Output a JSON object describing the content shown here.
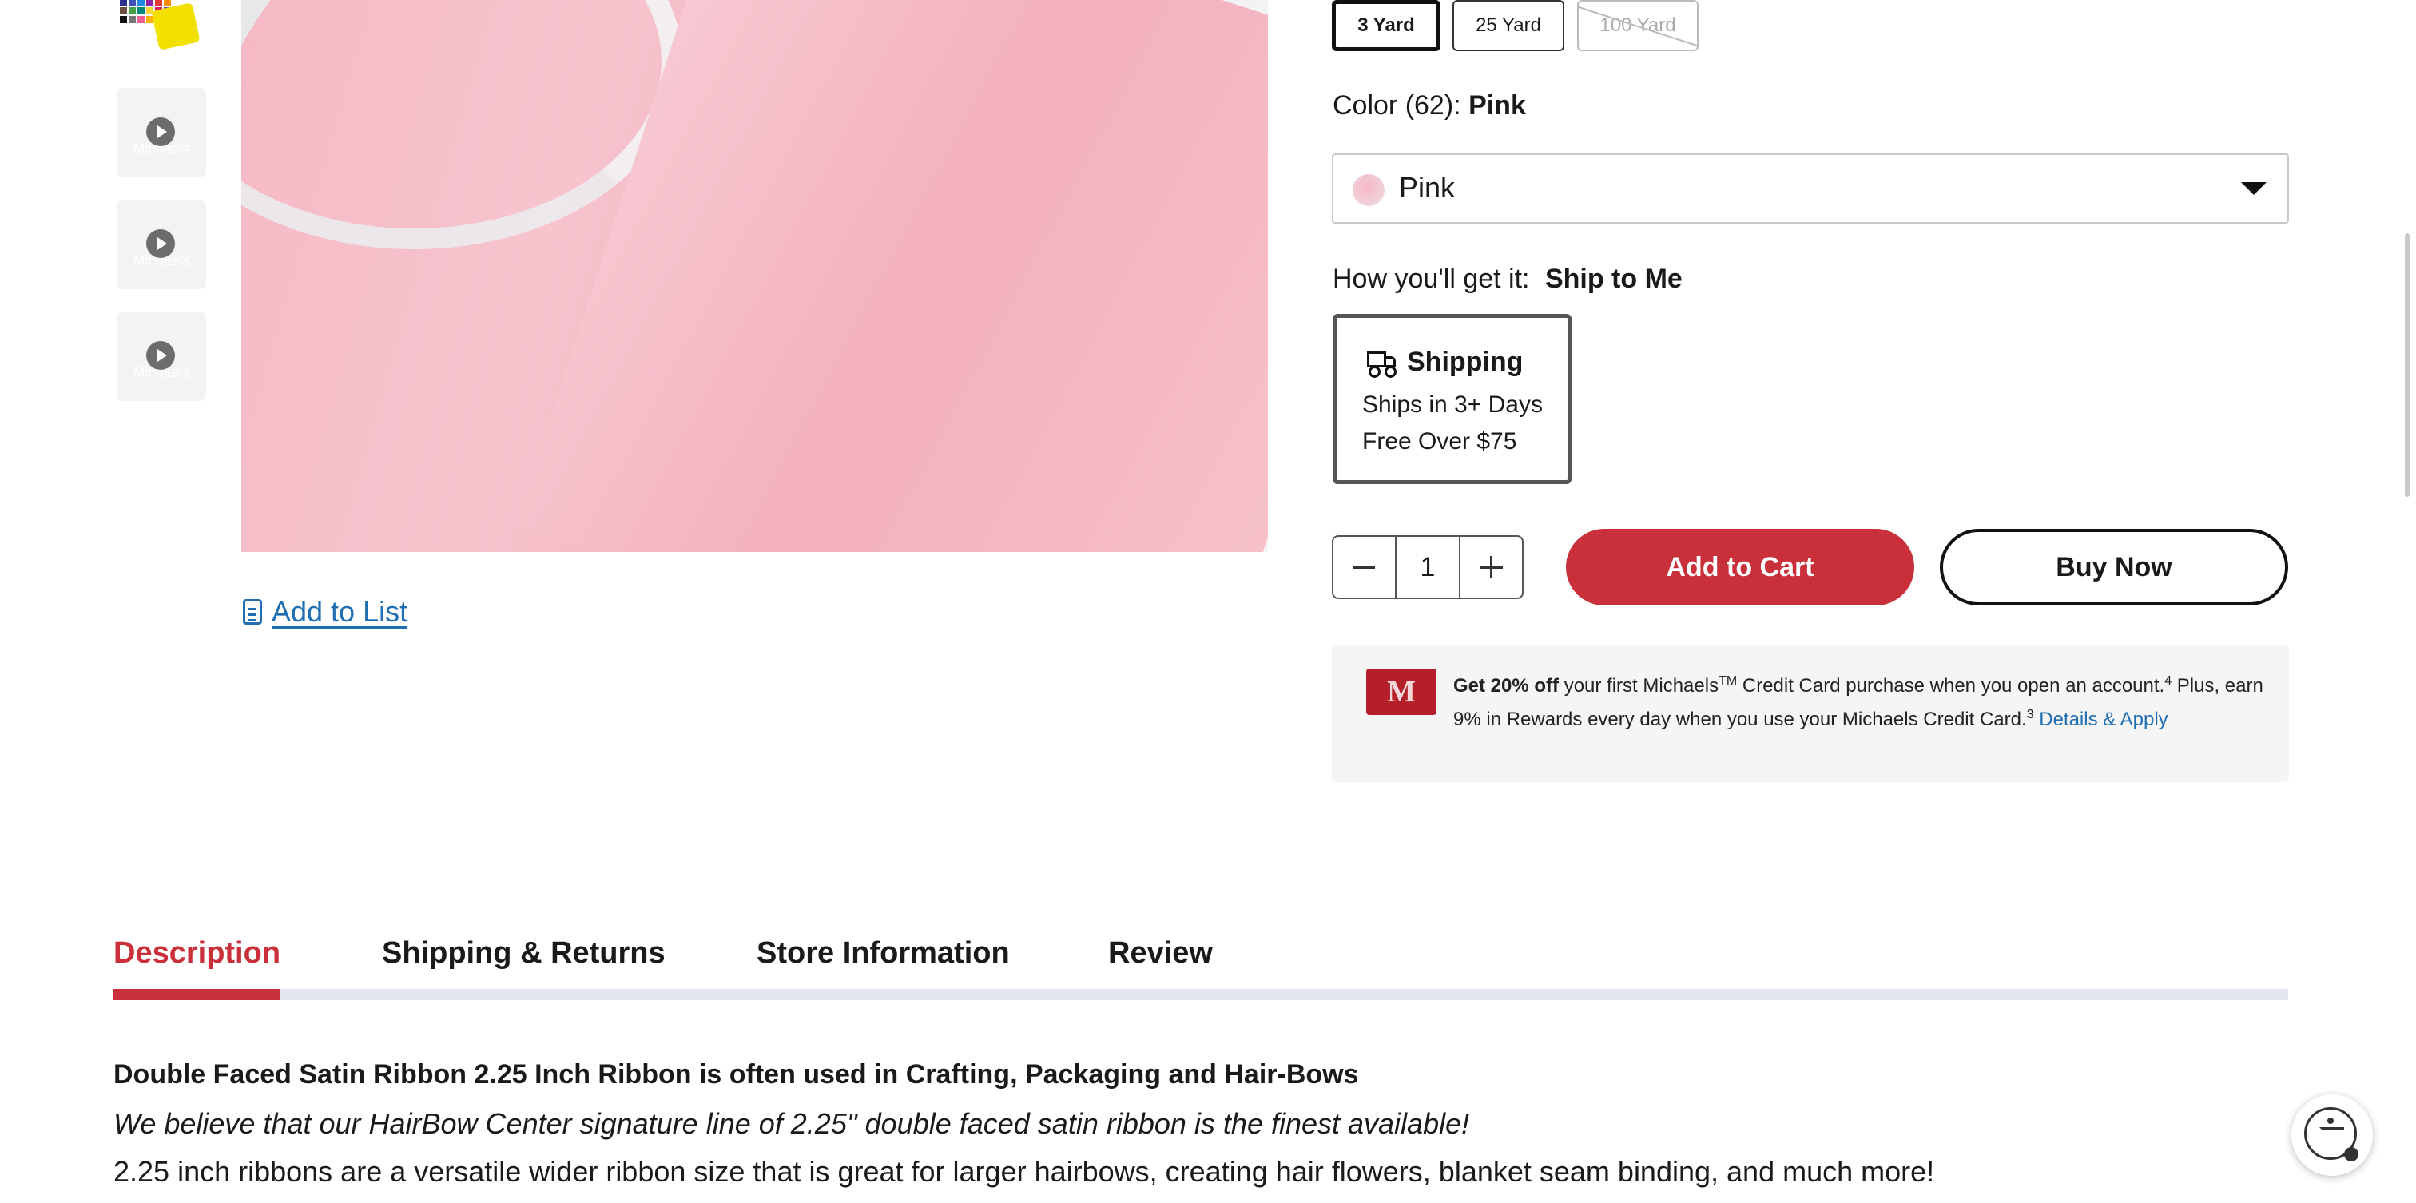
{
  "thumbnails": {
    "video_label": "Michaels",
    "swatch_colors": [
      "#2b2f8a",
      "#3f51b5",
      "#1e88e5",
      "#8e24aa",
      "#e53935",
      "#fb8c00",
      "#6d4c41",
      "#43a047",
      "#00897b",
      "#fdd835",
      "#d81b60",
      "#5e35b1",
      "#111111",
      "#757575",
      "#f06292",
      "#ffb300",
      "#26a69a",
      "#7b1fa2"
    ]
  },
  "product": {
    "add_to_list": "Add to List",
    "sizes": [
      {
        "label": "3 Yard",
        "state": "selected"
      },
      {
        "label": "25 Yard",
        "state": "available"
      },
      {
        "label": "100 Yard",
        "state": "unavailable"
      }
    ],
    "color_label": "Color (62):",
    "color_value": "Pink",
    "color_select_value": "Pink",
    "fulfillment_label": "How you'll get it:",
    "fulfillment_value": "Ship to Me",
    "shipping": {
      "title": "Shipping",
      "line1": "Ships in 3+ Days",
      "line2": "Free Over $75"
    },
    "quantity": "1",
    "add_to_cart": "Add to Cart",
    "buy_now": "Buy Now"
  },
  "promo": {
    "card_logo": "M",
    "bold": "Get 20% off",
    "text1": " your first Michaels",
    "tm": "TM",
    "text2": " Credit Card purchase when you open an account.",
    "sup1": "4",
    "text3": " Plus, earn 9% in Rewards every day when you use your Michaels Credit Card.",
    "sup2": "3",
    "link": "Details & Apply"
  },
  "tabs": [
    {
      "label": "Description",
      "active": true
    },
    {
      "label": "Shipping & Returns",
      "active": false
    },
    {
      "label": "Store Information",
      "active": false
    },
    {
      "label": "Review",
      "active": false
    }
  ],
  "description": {
    "heading": "Double Faced Satin Ribbon 2.25 Inch Ribbon is often used in Crafting, Packaging and Hair-Bows",
    "tagline": "We believe that our HairBow Center signature line of 2.25\" double faced satin ribbon is the finest available!",
    "paragraph": "2.25 inch ribbons are a versatile wider ribbon size that is great for larger hairbows, creating hair flowers, blanket seam binding, and much more!"
  },
  "colors": {
    "accent": "#c9303a",
    "link": "#1f6fb2"
  }
}
